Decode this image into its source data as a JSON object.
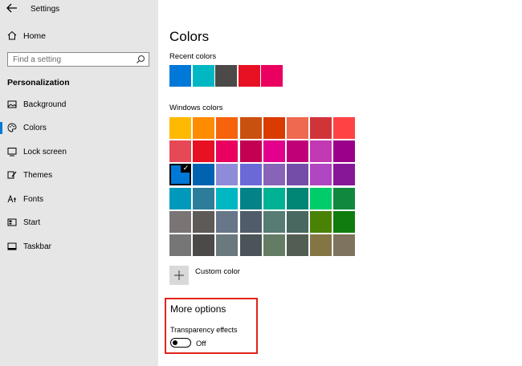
{
  "app": {
    "title": "Settings"
  },
  "sidebar": {
    "home_label": "Home",
    "search_placeholder": "Find a setting",
    "section_title": "Personalization",
    "items": [
      {
        "label": "Background",
        "icon": "image-icon"
      },
      {
        "label": "Colors",
        "icon": "palette-icon",
        "selected": true
      },
      {
        "label": "Lock screen",
        "icon": "lock-screen-icon"
      },
      {
        "label": "Themes",
        "icon": "brush-icon"
      },
      {
        "label": "Fonts",
        "icon": "font-icon"
      },
      {
        "label": "Start",
        "icon": "start-icon"
      },
      {
        "label": "Taskbar",
        "icon": "taskbar-icon"
      }
    ]
  },
  "main": {
    "title": "Colors",
    "recent_label": "Recent colors",
    "recent_colors": [
      "#0078d7",
      "#00b7c3",
      "#4c4a48",
      "#e81123",
      "#ea005e"
    ],
    "windows_label": "Windows colors",
    "windows_colors": [
      [
        "#ffb900",
        "#ff8c00",
        "#f7630c",
        "#ca5010",
        "#da3b01",
        "#ef6950",
        "#d13438",
        "#ff4343"
      ],
      [
        "#e74856",
        "#e81123",
        "#ea005e",
        "#c30052",
        "#e3008c",
        "#bf0077",
        "#c239b3",
        "#9a0089"
      ],
      [
        "#0078d7",
        "#0063b1",
        "#8e8cd8",
        "#6b69d6",
        "#8764b8",
        "#744da9",
        "#b146c2",
        "#881798"
      ],
      [
        "#0099bc",
        "#2d7d9a",
        "#00b7c3",
        "#038387",
        "#00b294",
        "#018574",
        "#00cc6a",
        "#10893e"
      ],
      [
        "#7a7574",
        "#5d5a58",
        "#68768a",
        "#515c6b",
        "#567c73",
        "#486860",
        "#498205",
        "#107c10"
      ],
      [
        "#767676",
        "#4c4a48",
        "#69797e",
        "#4a5459",
        "#647c64",
        "#525e54",
        "#847545",
        "#7e735f"
      ]
    ],
    "selected_color": "#0078d7",
    "custom_label": "Custom color",
    "more_options": {
      "title": "More options",
      "transparency_label": "Transparency effects",
      "toggle_state": "Off",
      "toggle_on": false
    }
  }
}
